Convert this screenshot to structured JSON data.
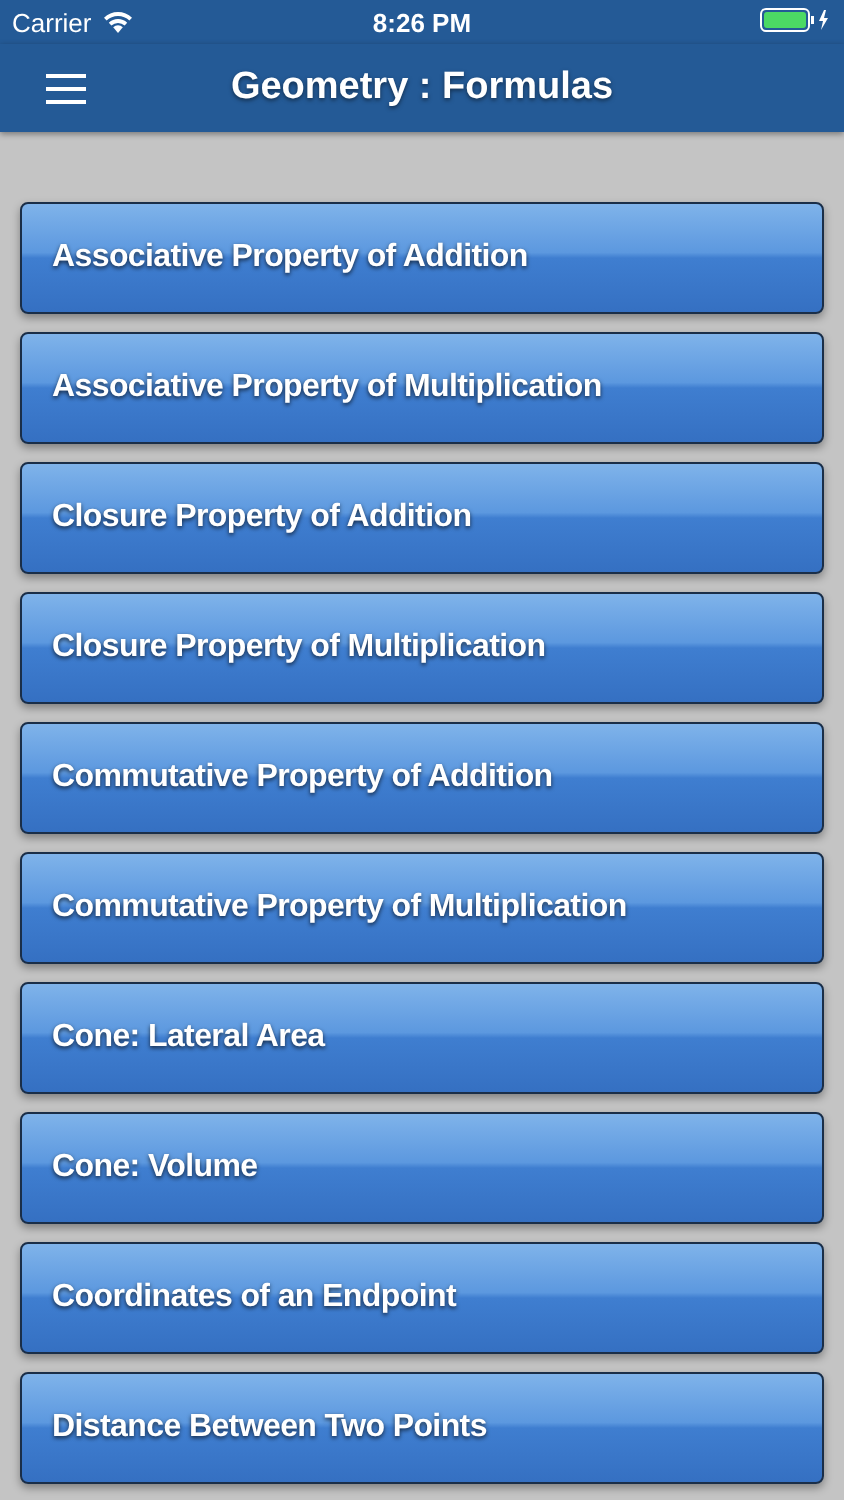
{
  "status_bar": {
    "carrier": "Carrier",
    "time": "8:26 PM"
  },
  "nav_bar": {
    "title": "Geometry : Formulas"
  },
  "items": [
    {
      "label": "Associative Property of Addition"
    },
    {
      "label": "Associative Property of Multiplication"
    },
    {
      "label": "Closure Property of Addition"
    },
    {
      "label": "Closure Property of Multiplication"
    },
    {
      "label": "Commutative Property of Addition"
    },
    {
      "label": "Commutative Property of Multiplication"
    },
    {
      "label": "Cone: Lateral Area"
    },
    {
      "label": "Cone: Volume"
    },
    {
      "label": "Coordinates of an Endpoint"
    },
    {
      "label": "Distance Between Two Points"
    }
  ]
}
